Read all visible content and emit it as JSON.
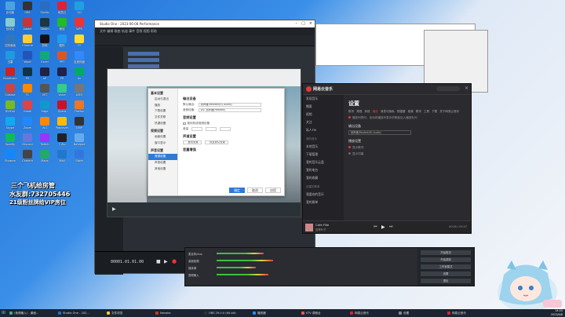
{
  "desktop": {
    "icons": [
      {
        "label": "此电脑",
        "color": "#4aa3df"
      },
      {
        "label": "OBS",
        "color": "#333"
      },
      {
        "label": "Studio",
        "color": "#2a6cc0"
      },
      {
        "label": "网易云",
        "color": "#d23"
      },
      {
        "label": "QQ",
        "color": "#1fa0e0"
      },
      {
        "label": "回收站",
        "color": "#8cc"
      },
      {
        "label": "Adobe",
        "color": "#c33"
      },
      {
        "label": "Steam",
        "color": "#234"
      },
      {
        "label": "微信",
        "color": "#2b2"
      },
      {
        "label": "WPS",
        "color": "#e33"
      },
      {
        "label": "控制面板",
        "color": "#37b"
      },
      {
        "label": "Chrome",
        "color": "#fc3"
      },
      {
        "label": "剪映",
        "color": "#111"
      },
      {
        "label": "酷狗",
        "color": "#29e"
      },
      {
        "label": "YY",
        "color": "#fd3"
      },
      {
        "label": "迅雷",
        "color": "#29d"
      },
      {
        "label": "Word",
        "color": "#25b"
      },
      {
        "label": "Excel",
        "color": "#1a7"
      },
      {
        "label": "PPT",
        "color": "#d52"
      },
      {
        "label": "百度网盘",
        "color": "#38f"
      },
      {
        "label": "Bandicam",
        "color": "#c22"
      },
      {
        "label": "PS",
        "color": "#134"
      },
      {
        "label": "AE",
        "color": "#224"
      },
      {
        "label": "PR",
        "color": "#224"
      },
      {
        "label": "Au",
        "color": "#0a6"
      },
      {
        "label": "Cubase",
        "color": "#c44"
      },
      {
        "label": "FL",
        "color": "#f80"
      },
      {
        "label": "VST",
        "color": "#555"
      },
      {
        "label": "Voice",
        "color": "#3c8"
      },
      {
        "label": "ASIO",
        "color": "#777"
      },
      {
        "label": "NVIDIA",
        "color": "#7b2"
      },
      {
        "label": "Gmail",
        "color": "#d44"
      },
      {
        "label": "Edge",
        "color": "#19c"
      },
      {
        "label": "Opera",
        "color": "#c12"
      },
      {
        "label": "Firefox",
        "color": "#e72"
      },
      {
        "label": "Skype",
        "color": "#1ae"
      },
      {
        "label": "Zoom",
        "color": "#28f"
      },
      {
        "label": "VLC",
        "color": "#f80"
      },
      {
        "label": "Potplayer",
        "color": "#fb0"
      },
      {
        "label": "KMP",
        "color": "#333"
      },
      {
        "label": "Spotify",
        "color": "#1b5"
      },
      {
        "label": "Discord",
        "color": "#67d"
      },
      {
        "label": "Twitch",
        "color": "#93f"
      },
      {
        "label": "7-Zip",
        "color": "#222"
      },
      {
        "label": "Notepad",
        "color": "#6ae"
      },
      {
        "label": "Shazam",
        "color": "#18f"
      },
      {
        "label": "Camera",
        "color": "#444"
      },
      {
        "label": "Maps",
        "color": "#2a6"
      },
      {
        "label": "Mail",
        "color": "#27c"
      },
      {
        "label": "Store",
        "color": "#37d"
      }
    ],
    "overlay_lines": [
      "三个飞机给房管",
      "水友群:732705446",
      "21级粉丝牌给VIP房位"
    ]
  },
  "studio_one": {
    "title": "Studio One - 2023-06-08 Performance",
    "menu": "文件  编辑  歌曲  轨道  事件  音频  视图  帮助",
    "timecode": "00001.01.01.00"
  },
  "video_player": {
    "settings": {
      "nav_sections": [
        {
          "header": "基本设置",
          "items": [
            "启动与退出",
            "播放",
            "下载设置",
            "文件关联",
            "热键设置"
          ]
        },
        {
          "header": "视频设置",
          "items": [
            "画面设置",
            "窗口显示"
          ]
        },
        {
          "header": "声音设置",
          "items": [
            "音频设备",
            "声音设置",
            "其他设置"
          ]
        }
      ],
      "selected_item": "音频设备",
      "content": {
        "sec1": "输出设备",
        "row1_label": "默认输出:",
        "row1_value": "扬声器(Realtek(R) Audio)",
        "row2_label": "音频设备:",
        "row2_value": "DS: 扬声器(Realtek)",
        "sec2": "音频设置",
        "check1": "使用系统音频设备",
        "vol_label": "音量",
        "sec3": "声道设置",
        "btn_sound": "音效设置",
        "btn_restore": "恢复默认设置",
        "sec4": "音量增强",
        "ok": "确定",
        "cancel": "取消",
        "apply": "应用"
      }
    }
  },
  "netease": {
    "brand": "网易云音乐",
    "sidebar": [
      "发现音乐",
      "播客",
      "视频",
      "关注",
      "私人FM"
    ],
    "sidebar_header": "我的音乐",
    "sidebar_items2": [
      "本地音乐",
      "下载管理",
      "我的音乐云盘",
      "我的电台",
      "我的收藏"
    ],
    "playlist_header": "创建的歌单",
    "playlists": [
      "我喜欢的音乐",
      "我的歌单"
    ],
    "title": "设置",
    "tabs": [
      "账号",
      "常规",
      "系统",
      "播放",
      "消息与隐私",
      "快捷键",
      "音频",
      "歌词",
      "工具",
      "下载",
      "关于网易云音乐"
    ],
    "active_tab": "播放",
    "line1": "播放列表时，自动将播放列表中的歌曲加入播放队列",
    "output_label": "输出设备",
    "output_value": "扬声器(Realtek(R) Audio)",
    "sub_label": "播放设置",
    "radios": [
      "显示歌词",
      "显示词幕"
    ],
    "song": "Cafe Fille",
    "artist": "四季叶子",
    "player_time": "00:00 / 03:47"
  },
  "obs": {
    "tracks": [
      "麦克风/Aux",
      "桌面音频",
      "媒体源",
      "音频输入"
    ],
    "controls": [
      "开始推流",
      "开始录制",
      "工作室模式",
      "设置",
      "退出"
    ]
  },
  "taskbar": {
    "items": [
      {
        "label": "(音频输入) - 桌面...",
        "color": "#4a8"
      },
      {
        "label": "Studio One - 202...",
        "color": "#2a6cc0"
      },
      {
        "label": "文件浏览",
        "color": "#fc3"
      },
      {
        "label": "Nevaka",
        "color": "#c33"
      },
      {
        "label": "OBS 29.0.0 (64-bit)",
        "color": "#333"
      },
      {
        "label": "播放器",
        "color": "#38f"
      },
      {
        "label": "KTV 调音台",
        "color": "#e55"
      },
      {
        "label": "网易云音乐",
        "color": "#d23"
      },
      {
        "label": "设置",
        "color": "#888"
      },
      {
        "label": "网易云音乐",
        "color": "#d23"
      }
    ],
    "time": "14:03",
    "date": "2023/6/8"
  }
}
